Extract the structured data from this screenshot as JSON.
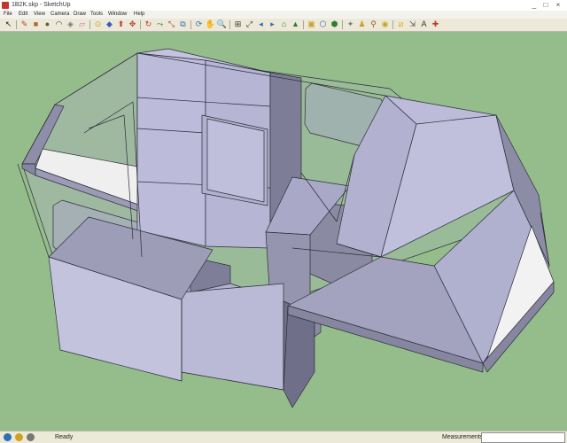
{
  "window": {
    "title": "1B2K.skp - SketchUp",
    "minimize": "_",
    "maximize": "□",
    "close": "×"
  },
  "menu": [
    "File",
    "Edit",
    "View",
    "Camera",
    "Draw",
    "Tools",
    "Window",
    "Help"
  ],
  "toolbar": [
    {
      "name": "select-icon",
      "glyph": "↖",
      "color": "#222222"
    },
    {
      "name": "pencil-icon",
      "glyph": "✎",
      "color": "#c0392b"
    },
    {
      "name": "rectangle-icon",
      "glyph": "■",
      "color": "#b5652a"
    },
    {
      "name": "circle-icon",
      "glyph": "●",
      "color": "#6b5a2e"
    },
    {
      "name": "arc-icon",
      "glyph": "◠",
      "color": "#333333"
    },
    {
      "name": "make-component-icon",
      "glyph": "◈",
      "color": "#7a7a7a"
    },
    {
      "name": "eraser-icon",
      "glyph": "▱",
      "color": "#d06aa0"
    },
    {
      "name": "tape-measure-icon",
      "glyph": "⊙",
      "color": "#c9a227"
    },
    {
      "name": "paint-bucket-icon",
      "glyph": "◆",
      "color": "#3a5dbb"
    },
    {
      "name": "push-pull-icon",
      "glyph": "⬆",
      "color": "#c0392b"
    },
    {
      "name": "move-icon",
      "glyph": "✥",
      "color": "#c0392b"
    },
    {
      "name": "rotate-icon",
      "glyph": "↻",
      "color": "#c0392b"
    },
    {
      "name": "follow-me-icon",
      "glyph": "⤳",
      "color": "#2e7d32"
    },
    {
      "name": "scale-icon",
      "glyph": "⤡",
      "color": "#c0392b"
    },
    {
      "name": "offset-icon",
      "glyph": "⧉",
      "color": "#2f6fb5"
    },
    {
      "name": "orbit-icon",
      "glyph": "⟳",
      "color": "#2f6fb5"
    },
    {
      "name": "pan-icon",
      "glyph": "✋",
      "color": "#c9a227"
    },
    {
      "name": "zoom-icon",
      "glyph": "🔍",
      "color": "#333333"
    },
    {
      "name": "zoom-window-icon",
      "glyph": "⊞",
      "color": "#333333"
    },
    {
      "name": "zoom-extents-icon",
      "glyph": "⤢",
      "color": "#333333"
    },
    {
      "name": "previous-view-icon",
      "glyph": "◂",
      "color": "#2f6fb5"
    },
    {
      "name": "next-view-icon",
      "glyph": "▸",
      "color": "#2f6fb5"
    },
    {
      "name": "add-location-icon",
      "glyph": "⌂",
      "color": "#2e7d32"
    },
    {
      "name": "toggle-terrain-icon",
      "glyph": "▲",
      "color": "#2e7d32"
    },
    {
      "name": "photo-textures-icon",
      "glyph": "▣",
      "color": "#c9a227"
    },
    {
      "name": "get-models-icon",
      "glyph": "⬡",
      "color": "#3a5dbb"
    },
    {
      "name": "share-model-icon",
      "glyph": "⬢",
      "color": "#2e7d32"
    },
    {
      "name": "share-component-icon",
      "glyph": "✦",
      "color": "#7a7a7a"
    },
    {
      "name": "position-camera-icon",
      "glyph": "♟",
      "color": "#c9a227"
    },
    {
      "name": "walk-icon",
      "glyph": "⚲",
      "color": "#8a5a2b"
    },
    {
      "name": "look-around-icon",
      "glyph": "◉",
      "color": "#c9a227"
    },
    {
      "name": "section-plane-icon",
      "glyph": "⧄",
      "color": "#e0a000"
    },
    {
      "name": "dimension-icon",
      "glyph": "⇲",
      "color": "#555555"
    },
    {
      "name": "text-icon",
      "glyph": "A",
      "color": "#333333"
    },
    {
      "name": "axes-icon",
      "glyph": "✚",
      "color": "#c0392b"
    }
  ],
  "status": {
    "text": "Ready",
    "measurements_label": "Measurements",
    "measurements_value": ""
  }
}
